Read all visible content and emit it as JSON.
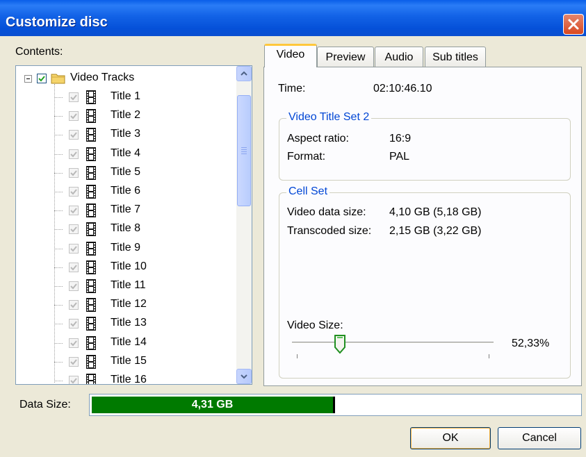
{
  "window": {
    "title": "Customize disc",
    "close_icon": "close-icon"
  },
  "contents": {
    "label": "Contents:",
    "root": {
      "label": "Video Tracks",
      "checked": true,
      "icon": "folder-icon"
    },
    "items": [
      {
        "label": "Title 1"
      },
      {
        "label": "Title 2"
      },
      {
        "label": "Title 3"
      },
      {
        "label": "Title 4"
      },
      {
        "label": "Title 5"
      },
      {
        "label": "Title 6"
      },
      {
        "label": "Title 7"
      },
      {
        "label": "Title 8"
      },
      {
        "label": "Title 9"
      },
      {
        "label": "Title 10"
      },
      {
        "label": "Title 11"
      },
      {
        "label": "Title 12"
      },
      {
        "label": "Title 13"
      },
      {
        "label": "Title 14"
      },
      {
        "label": "Title 15"
      },
      {
        "label": "Title 16"
      }
    ],
    "item_icon": "film-icon"
  },
  "tabs": [
    {
      "label": "Video",
      "active": true
    },
    {
      "label": "Preview"
    },
    {
      "label": "Audio"
    },
    {
      "label": "Sub titles"
    }
  ],
  "video": {
    "time_label": "Time:",
    "time_value": "02:10:46.10",
    "title_set": {
      "title": "Video Title Set 2",
      "aspect_label": "Aspect ratio:",
      "aspect_value": "16:9",
      "format_label": "Format:",
      "format_value": "PAL"
    },
    "cell_set": {
      "title": "Cell Set",
      "data_size_label": "Video data size:",
      "data_size_value": "4,10 GB (5,18 GB)",
      "transcoded_label": "Transcoded size:",
      "transcoded_value": "2,15 GB (3,22 GB)",
      "video_size_label": "Video Size:",
      "video_size_value": "52,33%",
      "slider_fraction": 0.22
    }
  },
  "data_size": {
    "label": "Data Size:",
    "value": "4,31 GB",
    "fill_fraction": 0.495,
    "fill_color": "#007a00"
  },
  "buttons": {
    "ok": "OK",
    "cancel": "Cancel"
  },
  "colors": {
    "titlebar": "#0a54e0",
    "group_title": "#0046d5",
    "dialog_bg": "#ece9d8"
  }
}
